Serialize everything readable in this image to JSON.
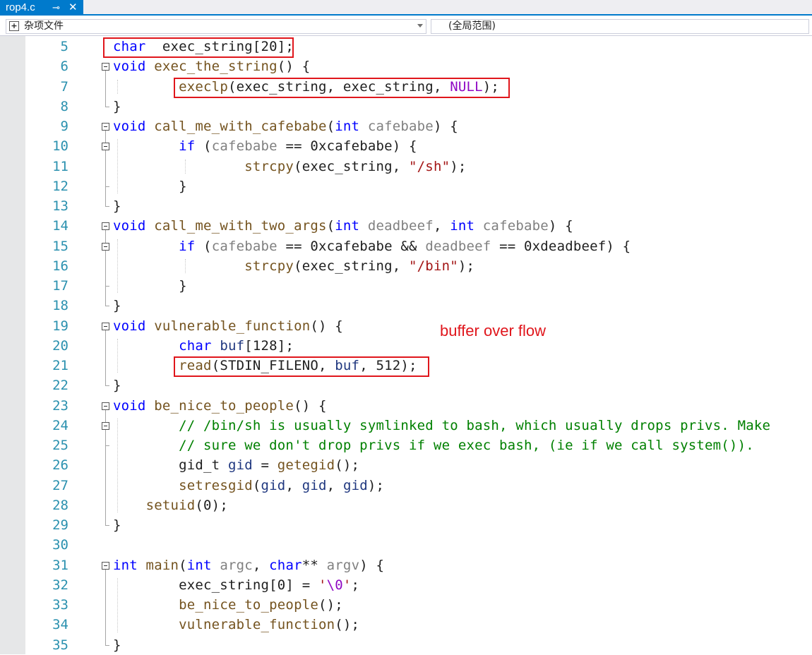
{
  "tab": {
    "title": "rop4.c",
    "pin_glyph": "⊸",
    "close_glyph": "✕"
  },
  "navbar": {
    "project": "杂项文件",
    "scope": "(全局范围)"
  },
  "annotation": "buffer over flow",
  "lines": [
    {
      "n": "5",
      "tokens": [
        [
          "kw",
          "char"
        ],
        [
          "",
          "  exec_string[20];"
        ]
      ]
    },
    {
      "n": "6",
      "tokens": [
        [
          "kw",
          "void"
        ],
        [
          "",
          ""
        ],
        [
          "fn",
          " exec_the_string"
        ],
        [
          "",
          "() {"
        ]
      ]
    },
    {
      "n": "7",
      "tokens": [
        [
          "",
          "        "
        ],
        [
          "fn",
          "execlp"
        ],
        [
          "",
          "(exec_string, exec_string, "
        ],
        [
          "mc",
          "NULL"
        ],
        [
          "",
          ");"
        ]
      ]
    },
    {
      "n": "8",
      "tokens": [
        [
          "",
          "}"
        ]
      ]
    },
    {
      "n": "9",
      "tokens": [
        [
          "kw",
          "void"
        ],
        [
          "fn",
          " call_me_with_cafebabe"
        ],
        [
          "",
          "("
        ],
        [
          "kw",
          "int"
        ],
        [
          "pr",
          " cafebabe"
        ],
        [
          "",
          ") {"
        ]
      ]
    },
    {
      "n": "10",
      "tokens": [
        [
          "",
          "        "
        ],
        [
          "kw",
          "if"
        ],
        [
          "",
          " ("
        ],
        [
          "pr",
          "cafebabe"
        ],
        [
          "",
          " == 0xcafebabe) {"
        ]
      ]
    },
    {
      "n": "11",
      "tokens": [
        [
          "",
          "                "
        ],
        [
          "fn",
          "strcpy"
        ],
        [
          "",
          "(exec_string, "
        ],
        [
          "st",
          "\"/sh\""
        ],
        [
          "",
          ");"
        ]
      ]
    },
    {
      "n": "12",
      "tokens": [
        [
          "",
          "        }"
        ]
      ]
    },
    {
      "n": "13",
      "tokens": [
        [
          "",
          "}"
        ]
      ]
    },
    {
      "n": "14",
      "tokens": [
        [
          "kw",
          "void"
        ],
        [
          "fn",
          " call_me_with_two_args"
        ],
        [
          "",
          "("
        ],
        [
          "kw",
          "int"
        ],
        [
          "pr",
          " deadbeef"
        ],
        [
          "",
          ", "
        ],
        [
          "kw",
          "int"
        ],
        [
          "pr",
          " cafebabe"
        ],
        [
          "",
          ") {"
        ]
      ]
    },
    {
      "n": "15",
      "tokens": [
        [
          "",
          "        "
        ],
        [
          "kw",
          "if"
        ],
        [
          "",
          " ("
        ],
        [
          "pr",
          "cafebabe"
        ],
        [
          "",
          " == 0xcafebabe && "
        ],
        [
          "pr",
          "deadbeef"
        ],
        [
          "",
          " == 0xdeadbeef) {"
        ]
      ]
    },
    {
      "n": "16",
      "tokens": [
        [
          "",
          "                "
        ],
        [
          "fn",
          "strcpy"
        ],
        [
          "",
          "(exec_string, "
        ],
        [
          "st",
          "\"/bin\""
        ],
        [
          "",
          ");"
        ]
      ]
    },
    {
      "n": "17",
      "tokens": [
        [
          "",
          "        }"
        ]
      ]
    },
    {
      "n": "18",
      "tokens": [
        [
          "",
          "}"
        ]
      ]
    },
    {
      "n": "19",
      "tokens": [
        [
          "kw",
          "void"
        ],
        [
          "fn",
          " vulnerable_function"
        ],
        [
          "",
          "() {"
        ]
      ]
    },
    {
      "n": "20",
      "tokens": [
        [
          "",
          "        "
        ],
        [
          "kw",
          "char"
        ],
        [
          "lv",
          " buf"
        ],
        [
          "",
          "[128];"
        ]
      ]
    },
    {
      "n": "21",
      "tokens": [
        [
          "",
          "        "
        ],
        [
          "fn",
          "read"
        ],
        [
          "",
          "(STDIN_FILENO, "
        ],
        [
          "lv",
          "buf"
        ],
        [
          "",
          ", 512);"
        ]
      ]
    },
    {
      "n": "22",
      "tokens": [
        [
          "",
          "}"
        ]
      ]
    },
    {
      "n": "23",
      "tokens": [
        [
          "kw",
          "void"
        ],
        [
          "fn",
          " be_nice_to_people"
        ],
        [
          "",
          "() {"
        ]
      ]
    },
    {
      "n": "24",
      "tokens": [
        [
          "",
          "        "
        ],
        [
          "cm",
          "// /bin/sh is usually symlinked to bash, which usually drops privs. Make"
        ]
      ]
    },
    {
      "n": "25",
      "tokens": [
        [
          "",
          "        "
        ],
        [
          "cm",
          "// sure we don't drop privs if we exec bash, (ie if we call system())."
        ]
      ]
    },
    {
      "n": "26",
      "tokens": [
        [
          "",
          "        gid_t "
        ],
        [
          "lv",
          "gid"
        ],
        [
          "",
          " = "
        ],
        [
          "fn",
          "getegid"
        ],
        [
          "",
          "();"
        ]
      ]
    },
    {
      "n": "27",
      "tokens": [
        [
          "",
          "        "
        ],
        [
          "fn",
          "setresgid"
        ],
        [
          "",
          "("
        ],
        [
          "lv",
          "gid"
        ],
        [
          "",
          ", "
        ],
        [
          "lv",
          "gid"
        ],
        [
          "",
          ", "
        ],
        [
          "lv",
          "gid"
        ],
        [
          "",
          ");"
        ]
      ]
    },
    {
      "n": "28",
      "tokens": [
        [
          "",
          "    "
        ],
        [
          "fn",
          "setuid"
        ],
        [
          "",
          "(0);"
        ]
      ]
    },
    {
      "n": "29",
      "tokens": [
        [
          "",
          "}"
        ]
      ]
    },
    {
      "n": "30",
      "tokens": []
    },
    {
      "n": "31",
      "tokens": [
        [
          "kw",
          "int"
        ],
        [
          "fn",
          " main"
        ],
        [
          "",
          "("
        ],
        [
          "kw",
          "int"
        ],
        [
          "pr",
          " argc"
        ],
        [
          "",
          ", "
        ],
        [
          "kw",
          "char"
        ],
        [
          "",
          "** "
        ],
        [
          "pr",
          "argv"
        ],
        [
          "",
          ") {"
        ]
      ]
    },
    {
      "n": "32",
      "tokens": [
        [
          "",
          "        exec_string[0] = "
        ],
        [
          "st",
          "'"
        ],
        [
          "mc",
          "\\0"
        ],
        [
          "st",
          "'"
        ],
        [
          "",
          ";"
        ]
      ]
    },
    {
      "n": "33",
      "tokens": [
        [
          "",
          "        "
        ],
        [
          "fn",
          "be_nice_to_people"
        ],
        [
          "",
          "();"
        ]
      ]
    },
    {
      "n": "34",
      "tokens": [
        [
          "",
          "        "
        ],
        [
          "fn",
          "vulnerable_function"
        ],
        [
          "",
          "();"
        ]
      ]
    },
    {
      "n": "35",
      "tokens": [
        [
          "",
          "}"
        ]
      ]
    }
  ]
}
